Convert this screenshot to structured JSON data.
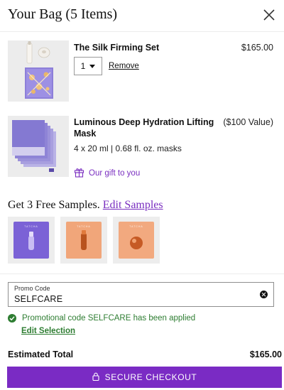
{
  "header": {
    "title": "Your Bag (5 Items)"
  },
  "items": [
    {
      "name": "The Silk Firming Set",
      "price": "$165.00",
      "quantity": "1",
      "remove_label": "Remove"
    },
    {
      "name": "Luminous Deep Hydration Lifting Mask",
      "price": "($100 Value)",
      "subtitle": "4 x 20 ml | 0.68 fl. oz. masks",
      "gift_label": "Our gift to you"
    }
  ],
  "samples": {
    "heading": "Get 3 Free Samples.",
    "edit_link": "Edit Samples",
    "brand_text": "TATCHA",
    "colors": [
      "#7b62d6",
      "#f1a67a",
      "#f2a97f"
    ]
  },
  "promo": {
    "label": "Promo Code",
    "value": "SELFCARE",
    "applied_message": "Promotional code SELFCARE has been applied",
    "edit_selection": "Edit Selection"
  },
  "summary": {
    "total_label": "Estimated Total",
    "total_value": "$165.00"
  },
  "checkout": {
    "label": "SECURE CHECKOUT"
  },
  "theme": {
    "accent": "#7a2bc4",
    "success": "#2e7d32"
  }
}
